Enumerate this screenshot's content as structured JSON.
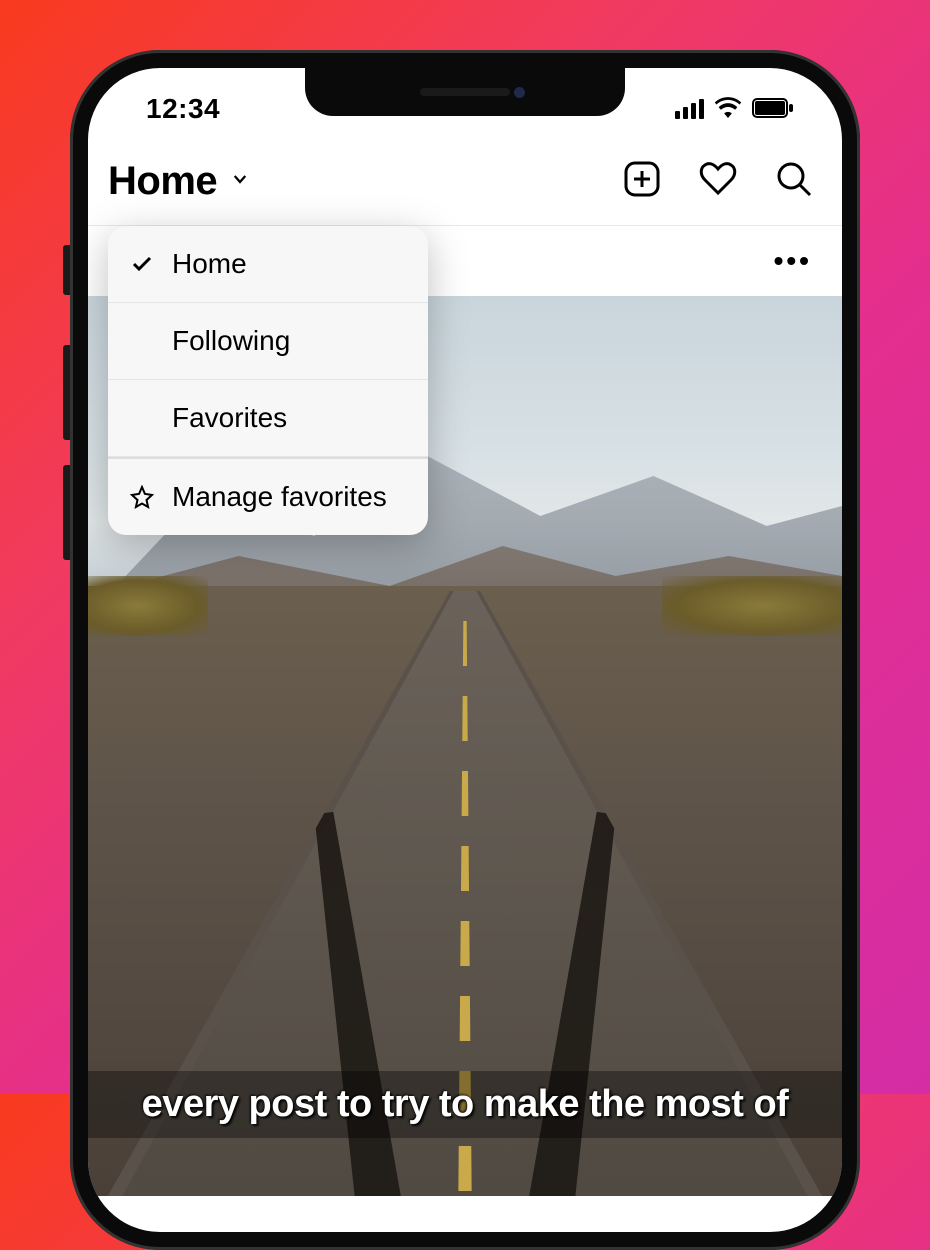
{
  "statusBar": {
    "time": "12:34"
  },
  "header": {
    "title": "Home"
  },
  "dropdown": {
    "items": [
      {
        "label": "Home",
        "icon": "check"
      },
      {
        "label": "Following",
        "icon": ""
      },
      {
        "label": "Favorites",
        "icon": ""
      },
      {
        "label": "Manage favorites",
        "icon": "star"
      }
    ]
  },
  "post": {
    "moreDots": "•••"
  },
  "caption": {
    "text": "every post to try to make the most of"
  }
}
